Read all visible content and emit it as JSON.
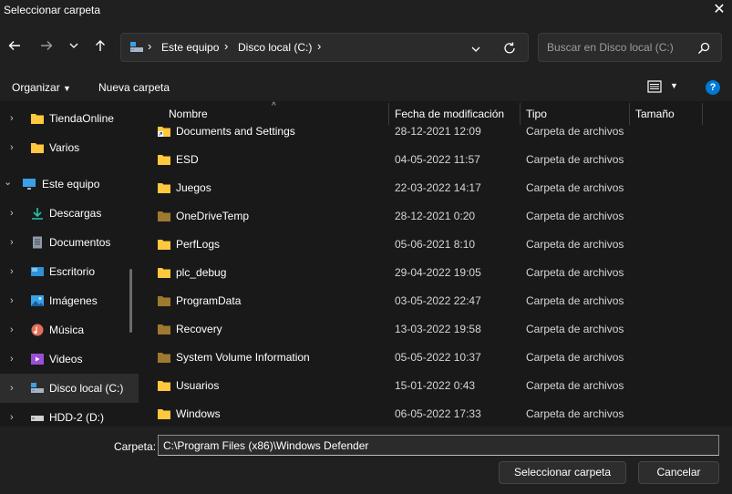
{
  "window": {
    "title": "Seleccionar carpeta",
    "close_glyph": "✕"
  },
  "navbar": {
    "back_icon": "arrow-left-icon",
    "forward_icon": "arrow-right-icon",
    "recent_icon": "chevron-down-icon",
    "up_icon": "arrow-up-icon",
    "breadcrumb": [
      "Este equipo",
      "Disco local (C:)"
    ],
    "search_placeholder": "Buscar en Disco local (C:)"
  },
  "commandbar": {
    "organize_label": "Organizar",
    "new_folder_label": "Nueva carpeta"
  },
  "sidebar": {
    "items": [
      {
        "label": "TiendaOnline",
        "icon": "folder-icon",
        "level": 1,
        "chevron": "›"
      },
      {
        "label": "Varios",
        "icon": "folder-icon",
        "level": 1,
        "chevron": "›"
      },
      {
        "label": "Este equipo",
        "icon": "computer-icon",
        "level": 0,
        "chevron": "⌄"
      },
      {
        "label": "Descargas",
        "icon": "download-icon",
        "level": 1,
        "chevron": "›"
      },
      {
        "label": "Documentos",
        "icon": "documents-icon",
        "level": 1,
        "chevron": "›"
      },
      {
        "label": "Escritorio",
        "icon": "desktop-icon",
        "level": 1,
        "chevron": "›"
      },
      {
        "label": "Imágenes",
        "icon": "pictures-icon",
        "level": 1,
        "chevron": "›"
      },
      {
        "label": "Música",
        "icon": "music-icon",
        "level": 1,
        "chevron": "›"
      },
      {
        "label": "Videos",
        "icon": "videos-icon",
        "level": 1,
        "chevron": "›"
      },
      {
        "label": "Disco local (C:)",
        "icon": "drive-icon",
        "level": 1,
        "chevron": "›",
        "selected": true
      },
      {
        "label": "HDD-2 (D:)",
        "icon": "hdd-icon",
        "level": 1,
        "chevron": "›"
      }
    ]
  },
  "filelist": {
    "columns": {
      "name": "Nombre",
      "date": "Fecha de modificación",
      "type": "Tipo",
      "size": "Tamaño"
    },
    "rows": [
      {
        "name": "Documents and Settings",
        "date": "28-12-2021 12:09",
        "type": "Carpeta de archivos",
        "shortcut": true
      },
      {
        "name": "ESD",
        "date": "04-05-2022 11:57",
        "type": "Carpeta de archivos"
      },
      {
        "name": "Juegos",
        "date": "22-03-2022 14:17",
        "type": "Carpeta de archivos"
      },
      {
        "name": "OneDriveTemp",
        "date": "28-12-2021 0:20",
        "type": "Carpeta de archivos",
        "dim": true
      },
      {
        "name": "PerfLogs",
        "date": "05-06-2021 8:10",
        "type": "Carpeta de archivos"
      },
      {
        "name": "plc_debug",
        "date": "29-04-2022 19:05",
        "type": "Carpeta de archivos"
      },
      {
        "name": "ProgramData",
        "date": "03-05-2022 22:47",
        "type": "Carpeta de archivos",
        "dim": true
      },
      {
        "name": "Recovery",
        "date": "13-03-2022 19:58",
        "type": "Carpeta de archivos",
        "dim": true
      },
      {
        "name": "System Volume Information",
        "date": "05-05-2022 10:37",
        "type": "Carpeta de archivos",
        "dim": true
      },
      {
        "name": "Usuarios",
        "date": "15-01-2022 0:43",
        "type": "Carpeta de archivos"
      },
      {
        "name": "Windows",
        "date": "06-05-2022 17:33",
        "type": "Carpeta de archivos"
      }
    ]
  },
  "bottom": {
    "folder_label": "Carpeta:",
    "folder_value": "C:\\Program Files (x86)\\Windows Defender",
    "select_label": "Seleccionar carpeta",
    "cancel_label": "Cancelar"
  },
  "colors": {
    "folder": "#ffc83d",
    "folder_dim": "#9c7a2e",
    "help": "#0078d4",
    "accent_drive": "#3aa0e8"
  }
}
